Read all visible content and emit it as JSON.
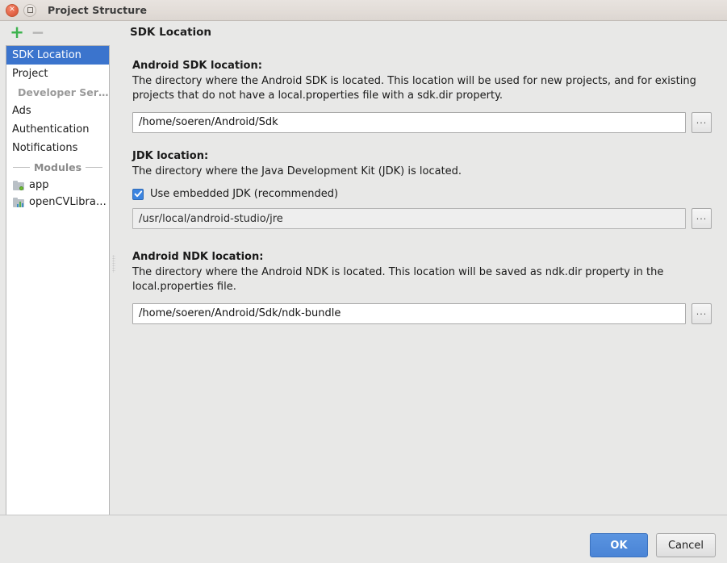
{
  "window": {
    "title": "Project Structure",
    "close_icon": "close-icon",
    "maximize_icon": "maximize-icon"
  },
  "sidebar": {
    "toolbar": {
      "add_label": "+",
      "remove_label": "−"
    },
    "items": [
      {
        "label": "SDK Location",
        "selected": true,
        "style": "normal"
      },
      {
        "label": "Project",
        "selected": false,
        "style": "normal"
      },
      {
        "label": "Developer Ser…",
        "selected": false,
        "style": "muted"
      },
      {
        "label": "Ads",
        "selected": false,
        "style": "normal"
      },
      {
        "label": "Authentication",
        "selected": false,
        "style": "normal"
      },
      {
        "label": "Notifications",
        "selected": false,
        "style": "normal"
      }
    ],
    "modules_separator": "Modules",
    "modules": [
      {
        "label": "app",
        "icon": "module-folder-icon"
      },
      {
        "label": "openCVLibra…",
        "icon": "library-module-icon"
      }
    ]
  },
  "content": {
    "page_title": "SDK Location",
    "sections": [
      {
        "label": "Android SDK location:",
        "description": "The directory where the Android SDK is located. This location will be used for new projects, and for existing projects that do not have a local.properties file with a sdk.dir property.",
        "value": "/home/soeren/Android/Sdk",
        "browse_label": "...",
        "disabled": false
      },
      {
        "label": "JDK location:",
        "description": "The directory where the Java Development Kit (JDK) is located.",
        "checkbox_label": "Use embedded JDK (recommended)",
        "checkbox_checked": true,
        "value": "/usr/local/android-studio/jre",
        "browse_label": "...",
        "disabled": true
      },
      {
        "label": "Android NDK location:",
        "description": "The directory where the Android NDK is located. This location will be saved as ndk.dir property in the local.properties file.",
        "value": "/home/soeren/Android/Sdk/ndk-bundle",
        "browse_label": "...",
        "disabled": false
      }
    ]
  },
  "footer": {
    "ok_label": "OK",
    "cancel_label": "Cancel"
  },
  "colors": {
    "selection_blue": "#3b74cd",
    "accent_button_blue": "#4a84d6",
    "checkbox_blue": "#3b84e0",
    "add_green": "#3eb34f",
    "window_bg": "#e8e8e7"
  }
}
